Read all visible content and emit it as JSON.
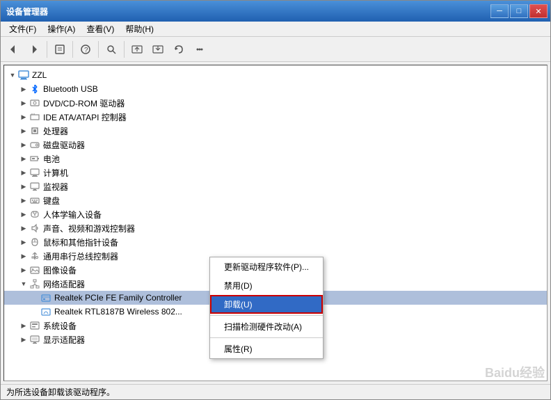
{
  "window": {
    "title": "设备管理器"
  },
  "titlebar": {
    "minimize": "─",
    "maximize": "□",
    "close": "✕"
  },
  "menu": {
    "items": [
      {
        "label": "文件(F)"
      },
      {
        "label": "操作(A)"
      },
      {
        "label": "查看(V)"
      },
      {
        "label": "帮助(H)"
      }
    ]
  },
  "toolbar": {
    "buttons": [
      {
        "name": "back",
        "icon": "◀"
      },
      {
        "name": "forward",
        "icon": "▶"
      },
      {
        "name": "properties",
        "icon": "📋"
      },
      {
        "name": "sep1",
        "type": "separator"
      },
      {
        "name": "help",
        "icon": "❓"
      },
      {
        "name": "sep2",
        "type": "separator"
      },
      {
        "name": "scan",
        "icon": "🔍"
      },
      {
        "name": "sep3",
        "type": "separator"
      },
      {
        "name": "update",
        "icon": "🔄"
      },
      {
        "name": "uninstall",
        "icon": "🗑"
      },
      {
        "name": "rollback",
        "icon": "↩"
      }
    ]
  },
  "tree": {
    "root": {
      "label": "ZZL",
      "expanded": true
    },
    "items": [
      {
        "indent": 1,
        "label": "Bluetooth USB",
        "icon": "bluetooth",
        "expand": true
      },
      {
        "indent": 1,
        "label": "DVD/CD-ROM 驱动器",
        "icon": "dvd",
        "expand": true
      },
      {
        "indent": 1,
        "label": "IDE ATA/ATAPI 控制器",
        "icon": "ide",
        "expand": true
      },
      {
        "indent": 1,
        "label": "处理器",
        "icon": "cpu",
        "expand": true
      },
      {
        "indent": 1,
        "label": "磁盘驱动器",
        "icon": "disk",
        "expand": true
      },
      {
        "indent": 1,
        "label": "电池",
        "icon": "battery",
        "expand": true
      },
      {
        "indent": 1,
        "label": "计算机",
        "icon": "computer2",
        "expand": true
      },
      {
        "indent": 1,
        "label": "监视器",
        "icon": "monitor",
        "expand": true
      },
      {
        "indent": 1,
        "label": "键盘",
        "icon": "keyboard",
        "expand": true
      },
      {
        "indent": 1,
        "label": "人体学输入设备",
        "icon": "input",
        "expand": true
      },
      {
        "indent": 1,
        "label": "声音、视频和游戏控制器",
        "icon": "sound",
        "expand": true
      },
      {
        "indent": 1,
        "label": "鼠标和其他指针设备",
        "icon": "mouse",
        "expand": true
      },
      {
        "indent": 1,
        "label": "通用串行总线控制器",
        "icon": "usb",
        "expand": true
      },
      {
        "indent": 1,
        "label": "图像设备",
        "icon": "image",
        "expand": true
      },
      {
        "indent": 1,
        "label": "网络适配器",
        "icon": "network",
        "expand": false,
        "selected": false
      },
      {
        "indent": 2,
        "label": "Realtek PCIe FE Family Controller",
        "icon": "realtek",
        "selected": true
      },
      {
        "indent": 2,
        "label": "Realtek RTL8187B Wireless 802...",
        "icon": "realtek2"
      },
      {
        "indent": 1,
        "label": "系统设备",
        "icon": "system",
        "expand": true
      },
      {
        "indent": 1,
        "label": "显示适配器",
        "icon": "display",
        "expand": true
      }
    ]
  },
  "context_menu": {
    "items": [
      {
        "label": "更新驱动程序软件(P)...",
        "hotkey": ""
      },
      {
        "label": "禁用(D)",
        "hotkey": ""
      },
      {
        "label": "卸载(U)",
        "hotkey": "",
        "active": true
      },
      {
        "label": "扫描检测硬件改动(A)",
        "hotkey": ""
      },
      {
        "label": "属性(R)",
        "hotkey": ""
      }
    ]
  },
  "status_bar": {
    "text": "为所选设备卸载该驱动程序。"
  },
  "watermark": "Baidu经验"
}
